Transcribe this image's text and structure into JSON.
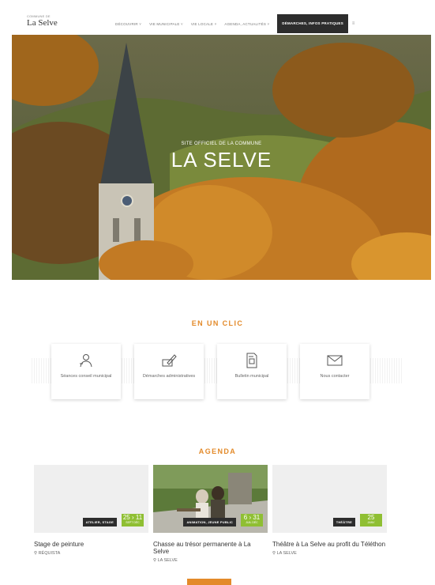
{
  "logo": {
    "small": "COMMUNE DE",
    "main": "La Selve"
  },
  "nav": {
    "items": [
      "DÉCOUVRIR ˅",
      "VIE MUNICIPALE ˅",
      "VIE LOCALE ˅",
      "AGENDA, ACTUALITÉS ˅"
    ],
    "active": "DÉMARCHES, INFOS PRATIQUES",
    "menu_icon": "≡"
  },
  "hero": {
    "subtitle": "SITE OFFICIEL DE LA COMMUNE",
    "title": "LA SELVE"
  },
  "en_un_clic": {
    "title": "EN UN CLIC",
    "cards": [
      {
        "label": "Séances conseil municipal",
        "icon": "people-icon"
      },
      {
        "label": "Démarches administratives",
        "icon": "form-pen-icon"
      },
      {
        "label": "Bulletin municipal",
        "icon": "document-icon"
      },
      {
        "label": "Nous contacter",
        "icon": "envelope-icon"
      }
    ]
  },
  "agenda": {
    "title": "AGENDA",
    "events": [
      {
        "tag": "ATELIER, STAGE",
        "date_day": "25 › 11",
        "date_month": "SEPT DÉC",
        "title": "Stage de peinture",
        "location": "RÉQUISTA"
      },
      {
        "tag": "ANIMATION, JEUNE PUBLIC",
        "date_day": "6 › 31",
        "date_month": "JUIL DÉC",
        "title": "Chasse au trésor permanente à La Selve",
        "location": "LA SELVE"
      },
      {
        "tag": "THÉÂTRE",
        "date_day": "25",
        "date_month": "JANV",
        "title": "Théâtre à La Selve au profit du Téléthon",
        "location": "LA SELVE"
      }
    ],
    "more_button": ""
  },
  "colors": {
    "accent": "#e38a2a",
    "dark": "#2d2d2d",
    "date_green": "#8fbf33"
  }
}
